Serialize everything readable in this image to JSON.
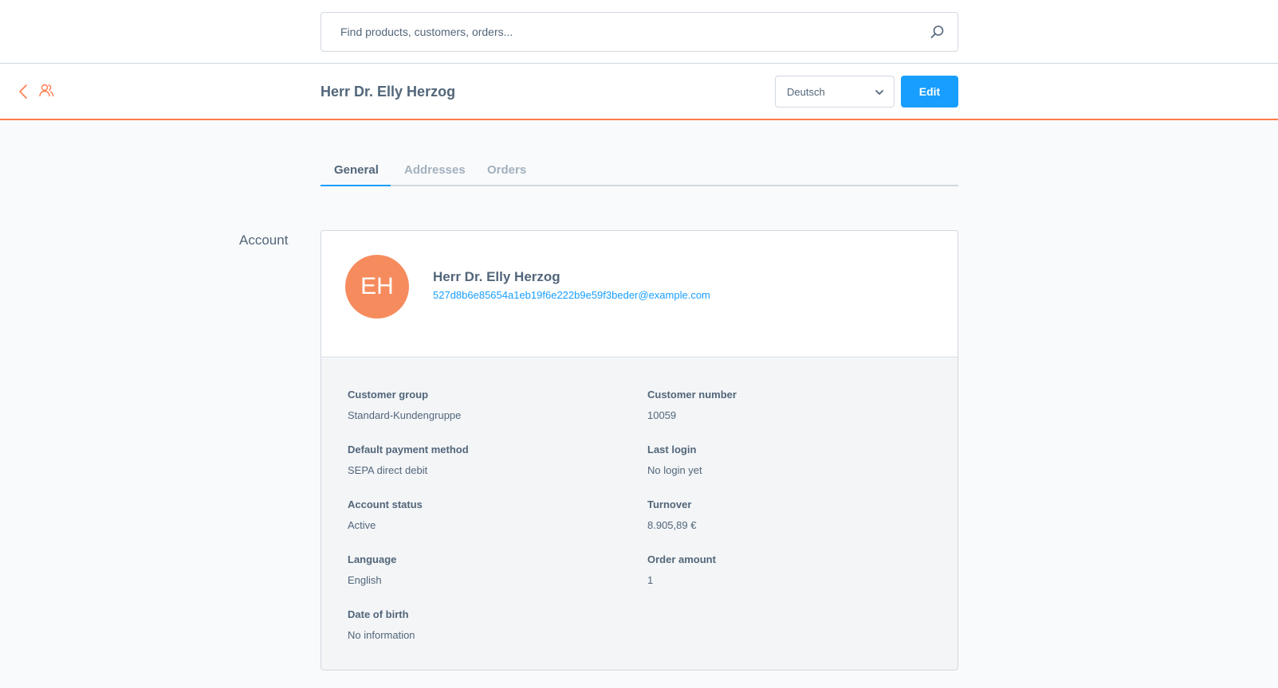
{
  "search": {
    "placeholder": "Find products, customers, orders..."
  },
  "header": {
    "title": "Herr Dr. Elly Herzog",
    "language": "Deutsch",
    "edit_label": "Edit"
  },
  "tabs": [
    {
      "label": "General",
      "active": true
    },
    {
      "label": "Addresses",
      "active": false
    },
    {
      "label": "Orders",
      "active": false
    }
  ],
  "account": {
    "section_label": "Account",
    "initials": "EH",
    "name": "Herr Dr. Elly Herzog",
    "email": "527d8b6e85654a1eb19f6e222b9e59f3beder@example.com",
    "fields": {
      "customer_group": {
        "label": "Customer group",
        "value": "Standard-Kundengruppe"
      },
      "customer_number": {
        "label": "Customer number",
        "value": "10059"
      },
      "payment_method": {
        "label": "Default payment method",
        "value": "SEPA direct debit"
      },
      "last_login": {
        "label": "Last login",
        "value": "No login yet"
      },
      "account_status": {
        "label": "Account status",
        "value": "Active"
      },
      "turnover": {
        "label": "Turnover",
        "value": "8.905,89 €"
      },
      "language": {
        "label": "Language",
        "value": "English"
      },
      "order_amount": {
        "label": "Order amount",
        "value": "1"
      },
      "date_of_birth": {
        "label": "Date of birth",
        "value": "No information"
      }
    }
  },
  "colors": {
    "accent": "#189eff",
    "brand": "#ff7c4d",
    "avatar": "#f68b5d",
    "text": "#52667a"
  },
  "icons": {
    "search": "search-icon",
    "back": "chevron-left-icon",
    "module": "users-icon",
    "dropdown": "chevron-down-icon"
  }
}
